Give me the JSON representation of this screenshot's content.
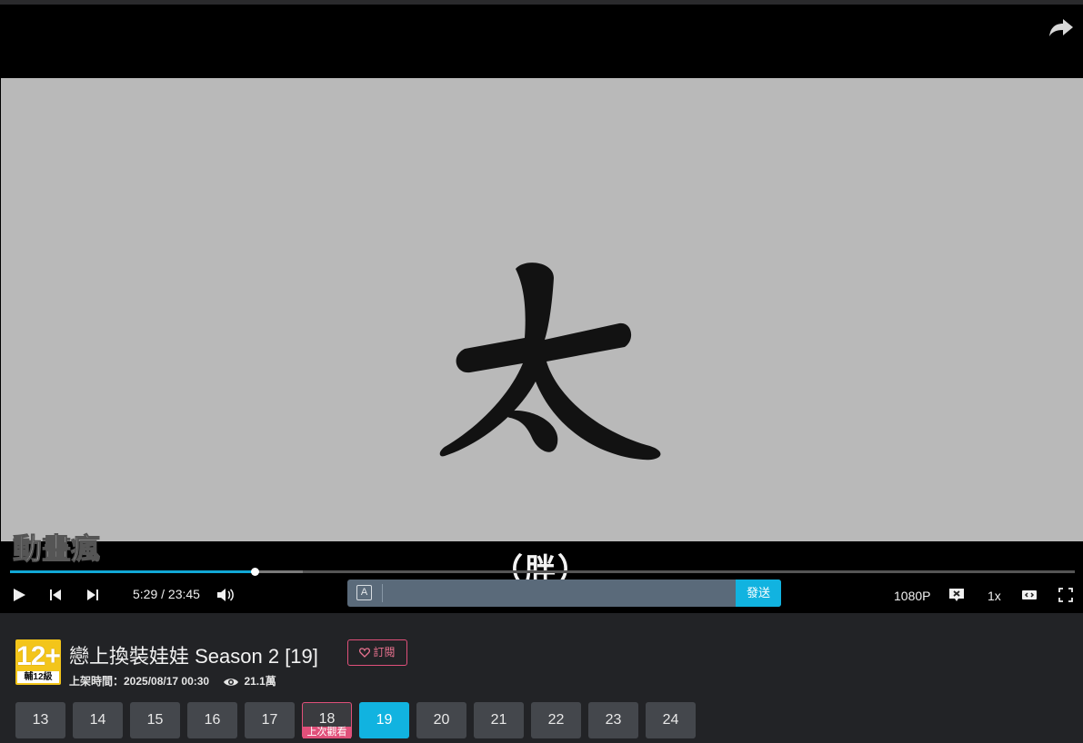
{
  "player": {
    "subtitle": "（胖）",
    "current_time": "5:29",
    "time_separator": "/",
    "duration": "23:45",
    "progress_fraction": 0.23,
    "buffer_fraction": 0.275,
    "danmaku_mode_label": "A",
    "danmaku_placeholder": "",
    "send_label": "發送",
    "quality_label": "1080P",
    "speed_label": "1x",
    "watermark_text": "動畫瘋"
  },
  "anime": {
    "rating_number": "12+",
    "rating_label": "輔12級",
    "title": "戀上換裝娃娃 Season 2 [19]",
    "subscribe_label": "訂閱",
    "upload_label": "上架時間：2025/08/17 00:30",
    "views": "21.1萬"
  },
  "episodes": {
    "items": [
      "13",
      "14",
      "15",
      "16",
      "17",
      "18",
      "19",
      "20",
      "21",
      "22",
      "23",
      "24"
    ],
    "current": "19",
    "last_watched": "18",
    "last_watched_label": "上次觀看"
  },
  "colors": {
    "accent": "#11b3e0",
    "subscribe": "#e0507a",
    "rating": "#f3c51a"
  }
}
